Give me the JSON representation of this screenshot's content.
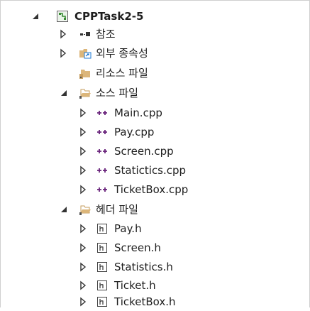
{
  "tree": {
    "project": {
      "label": "CPPTask2-5",
      "icon": "solution-project-icon",
      "expanded": true
    },
    "items": [
      {
        "label": "참조",
        "icon": "references-icon",
        "expanded": false,
        "level": 1
      },
      {
        "label": "외부 종속성",
        "icon": "external-dependencies-icon",
        "expanded": false,
        "level": 1
      },
      {
        "label": "리소스 파일",
        "icon": "folder-filter-icon",
        "expanded": null,
        "level": 1
      },
      {
        "label": "소스 파일",
        "icon": "folder-filter-open-icon",
        "expanded": true,
        "level": 1
      },
      {
        "label": "Main.cpp",
        "icon": "cpp-file-icon",
        "expanded": false,
        "level": 2
      },
      {
        "label": "Pay.cpp",
        "icon": "cpp-file-icon",
        "expanded": false,
        "level": 2
      },
      {
        "label": "Screen.cpp",
        "icon": "cpp-file-icon",
        "expanded": false,
        "level": 2
      },
      {
        "label": "Statictics.cpp",
        "icon": "cpp-file-icon",
        "expanded": false,
        "level": 2
      },
      {
        "label": "TicketBox.cpp",
        "icon": "cpp-file-icon",
        "expanded": false,
        "level": 2
      },
      {
        "label": "헤더 파일",
        "icon": "folder-filter-open-icon",
        "expanded": true,
        "level": 1
      },
      {
        "label": "Pay.h",
        "icon": "header-file-icon",
        "expanded": false,
        "level": 2
      },
      {
        "label": "Screen.h",
        "icon": "header-file-icon",
        "expanded": false,
        "level": 2
      },
      {
        "label": "Statistics.h",
        "icon": "header-file-icon",
        "expanded": false,
        "level": 2
      },
      {
        "label": "Ticket.h",
        "icon": "header-file-icon",
        "expanded": false,
        "level": 2
      },
      {
        "label": "TicketBox.h",
        "icon": "header-file-icon",
        "expanded": false,
        "level": 2
      }
    ]
  },
  "colors": {
    "cpp_icon": "#68217a",
    "folder": "#dcb67a",
    "project_icon": "#388a34",
    "text": "#1e1e1e"
  }
}
